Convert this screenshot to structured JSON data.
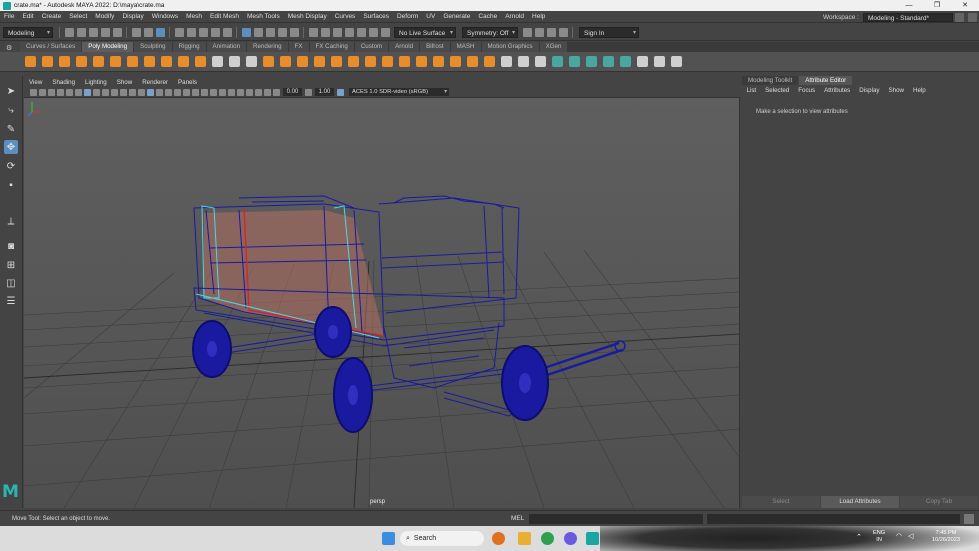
{
  "window": {
    "title": "crate.ma* - Autodesk MAYA 2022: D:\\maya\\crate.ma",
    "minimize": "—",
    "maximize": "❐",
    "close": "✕"
  },
  "menubar": {
    "items": [
      "File",
      "Edit",
      "Create",
      "Select",
      "Modify",
      "Display",
      "Windows",
      "Mesh",
      "Edit Mesh",
      "Mesh Tools",
      "Mesh Display",
      "Curves",
      "Surfaces",
      "Deform",
      "UV",
      "Generate",
      "Cache",
      "Arnold",
      "Help"
    ],
    "workspace_label": "Workspace :",
    "workspace_value": "Modeling - Standard*"
  },
  "statusline": {
    "mode": "Modeling",
    "live_surface": "No Live Surface",
    "symmetry": "Symmetry: Off",
    "sign_in": "Sign In"
  },
  "shelf": {
    "tabs": [
      "Curves / Surfaces",
      "Poly Modeling",
      "Sculpting",
      "Rigging",
      "Animation",
      "Rendering",
      "FX",
      "FX Caching",
      "Custom",
      "Arnold",
      "Bifrost",
      "MASH",
      "Motion Graphics",
      "XGen"
    ],
    "active_tab": "Poly Modeling"
  },
  "viewport": {
    "menu": [
      "View",
      "Shading",
      "Lighting",
      "Show",
      "Renderer",
      "Panels"
    ],
    "exposure": "0.00",
    "gamma": "1.00",
    "color_space": "ACES 1.0 SDR-video (sRGB)",
    "camera": "persp"
  },
  "rightpanel": {
    "tabs": [
      "Modeling Toolkit",
      "Attribute Editor"
    ],
    "active_tab": "Attribute Editor",
    "menu": [
      "List",
      "Selected",
      "Focus",
      "Attributes",
      "Display",
      "Show",
      "Help"
    ],
    "message": "Make a selection to view attributes",
    "buttons": [
      "Select",
      "Load Attributes",
      "Copy Tab"
    ]
  },
  "helpline": {
    "text": "Move Tool: Select an object to move.",
    "mel": "MEL"
  },
  "taskbar": {
    "search": "Search",
    "lang1": "ENG",
    "lang2": "IN",
    "time": "7:45 PM",
    "date": "10/26/2023"
  },
  "colors": {
    "accent": "#5a8fc0",
    "maya_teal": "#2ab5b0",
    "wire_blue": "#1a1aa0",
    "wire_selected_red": "#e02020",
    "wire_cyan": "#4dd6e8"
  }
}
